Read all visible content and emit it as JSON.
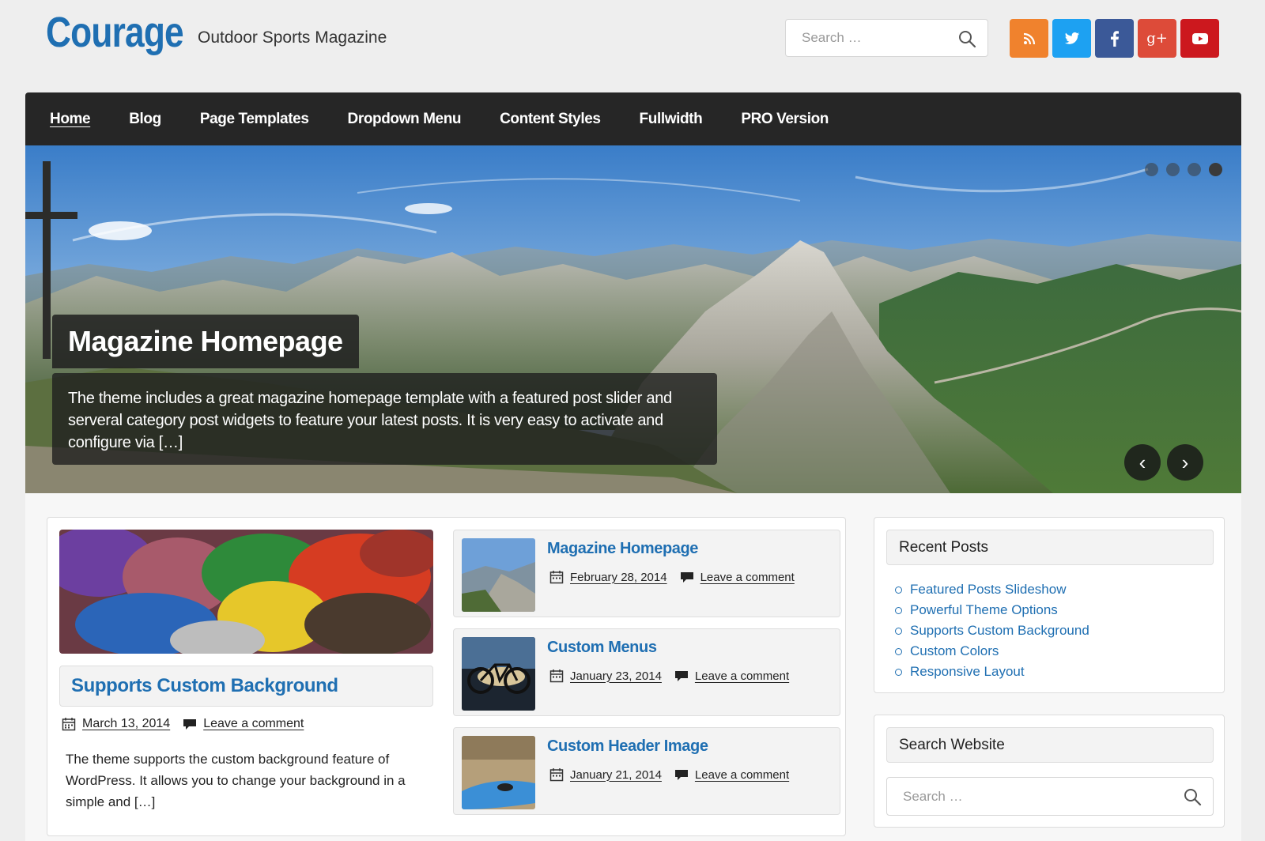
{
  "site": {
    "title": "Courage",
    "tagline": "Outdoor Sports Magazine",
    "search_placeholder": "Search …",
    "social": [
      {
        "name": "rss",
        "icon": "rss-icon",
        "color": "#f0822d",
        "glyph": "◢"
      },
      {
        "name": "twitter",
        "icon": "twitter-icon",
        "color": "#1da1f2",
        "glyph": "t"
      },
      {
        "name": "facebook",
        "icon": "facebook-icon",
        "color": "#3b5998",
        "glyph": "f"
      },
      {
        "name": "google-plus",
        "icon": "google-plus-icon",
        "color": "#dd4b39",
        "glyph": "g+"
      },
      {
        "name": "youtube",
        "icon": "youtube-icon",
        "color": "#cc181e",
        "glyph": "▶"
      }
    ]
  },
  "nav": {
    "items": [
      "Home",
      "Blog",
      "Page Templates",
      "Dropdown Menu",
      "Content Styles",
      "Fullwidth",
      "PRO Version"
    ],
    "active_index": 0
  },
  "slider": {
    "title": "Magazine Homepage",
    "excerpt": "The theme includes a great magazine homepage template with a featured post slider and serveral category post widgets to feature your latest posts. It is very easy to activate and configure via […]",
    "dots": 4,
    "active_dot": 3,
    "prev_glyph": "‹",
    "next_glyph": "›"
  },
  "featured_post": {
    "title": "Supports Custom Background",
    "date": "March 13, 2014",
    "comment_link": "Leave a comment",
    "excerpt": "The theme supports the custom background feature of WordPress. It allows you to change your background in a simple and […]"
  },
  "small_posts": [
    {
      "title": "Magazine Homepage",
      "date": "February 28, 2014",
      "comment_link": "Leave a comment"
    },
    {
      "title": "Custom Menus",
      "date": "January 23, 2014",
      "comment_link": "Leave a comment"
    },
    {
      "title": "Custom Header Image",
      "date": "January 21, 2014",
      "comment_link": "Leave a comment"
    }
  ],
  "widgets": {
    "recent_posts": {
      "title": "Recent Posts",
      "items": [
        "Featured Posts Slideshow",
        "Powerful Theme Options",
        "Supports Custom Background",
        "Custom Colors",
        "Responsive Layout"
      ]
    },
    "search": {
      "title": "Search Website",
      "placeholder": "Search …"
    }
  },
  "colors": {
    "accent": "#1f6fb2",
    "nav_bg": "#262626",
    "page_bg": "#eeeeee"
  }
}
